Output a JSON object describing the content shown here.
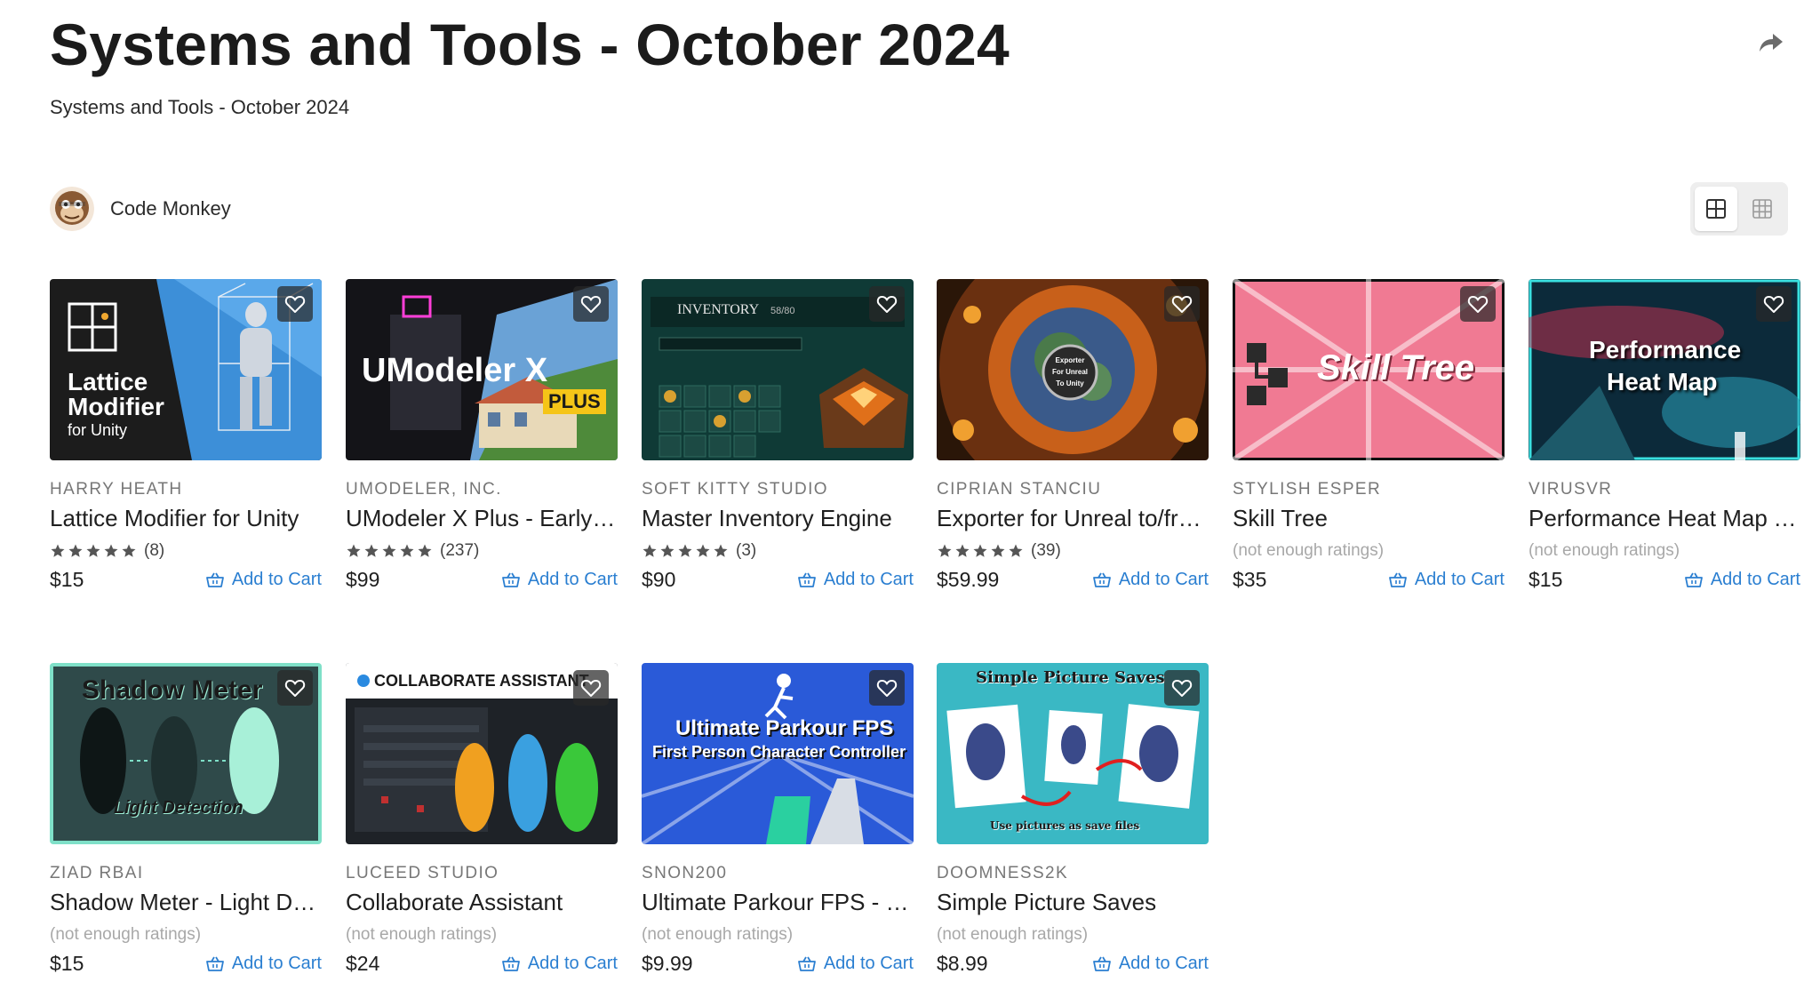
{
  "page": {
    "title": "Systems and Tools - October 2024",
    "subtitle": "Systems and Tools - October 2024"
  },
  "author": {
    "name": "Code Monkey"
  },
  "icons": {
    "share": "share-arrow-icon",
    "grid_large": "grid-large-icon",
    "grid_small": "grid-small-icon",
    "favorite": "heart-icon",
    "cart": "cart-icon",
    "star": "star-icon"
  },
  "colors": {
    "link": "#2b7fd1",
    "muted": "#a8a8a8",
    "publisher": "#777777"
  },
  "products": [
    {
      "publisher": "HARRY HEATH",
      "name": "Lattice Modifier for Unity",
      "rating_count": "(8)",
      "rated": true,
      "stars": 5,
      "price": "$15",
      "cart": "Add to Cart",
      "thumb_title": "Lattice",
      "thumb_title2": "Modifier",
      "thumb_sub": "for Unity"
    },
    {
      "publisher": "UMODELER, INC.",
      "name": "UModeler X Plus - Early Access",
      "rating_count": "(237)",
      "rated": true,
      "stars": 5,
      "price": "$99",
      "cart": "Add to Cart",
      "thumb_title": "UModeler X",
      "thumb_sub": "PLUS"
    },
    {
      "publisher": "SOFT KITTY STUDIO",
      "name": "Master Inventory Engine",
      "rating_count": "(3)",
      "rated": true,
      "stars": 5,
      "price": "$90",
      "cart": "Add to Cart",
      "thumb_title": "INVENTORY",
      "thumb_sub": "58/80"
    },
    {
      "publisher": "CIPRIAN STANCIU",
      "name": "Exporter for Unreal to/from Unity",
      "rating_count": "(39)",
      "rated": true,
      "stars": 5,
      "price": "$59.99",
      "cart": "Add to Cart",
      "thumb_title": "Exporter",
      "thumb_title2": "For Unreal",
      "thumb_sub": "To Unity"
    },
    {
      "publisher": "STYLISH ESPER",
      "name": "Skill Tree",
      "no_rating": "(not enough ratings)",
      "rated": false,
      "price": "$35",
      "cart": "Add to Cart",
      "thumb_title": "Skill Tree"
    },
    {
      "publisher": "VIRUSVR",
      "name": "Performance Heat Map Tool",
      "no_rating": "(not enough ratings)",
      "rated": false,
      "price": "$15",
      "cart": "Add to Cart",
      "thumb_title": "Performance",
      "thumb_sub": "Heat Map"
    },
    {
      "publisher": "ZIAD RBAI",
      "name": "Shadow Meter - Light Detection",
      "no_rating": "(not enough ratings)",
      "rated": false,
      "price": "$15",
      "cart": "Add to Cart",
      "thumb_title": "Shadow Meter",
      "thumb_sub": "Light Detection"
    },
    {
      "publisher": "LUCEED STUDIO",
      "name": "Collaborate Assistant",
      "no_rating": "(not enough ratings)",
      "rated": false,
      "price": "$24",
      "cart": "Add to Cart",
      "thumb_title": "COLLABORATE ASSISTANT"
    },
    {
      "publisher": "SNON200",
      "name": "Ultimate Parkour FPS - First Person Character Controller",
      "no_rating": "(not enough ratings)",
      "rated": false,
      "price": "$9.99",
      "cart": "Add to Cart",
      "thumb_title": "Ultimate Parkour FPS",
      "thumb_sub": "First Person Character Controller"
    },
    {
      "publisher": "DOOMNESS2K",
      "name": "Simple Picture Saves",
      "no_rating": "(not enough ratings)",
      "rated": false,
      "price": "$8.99",
      "cart": "Add to Cart",
      "thumb_title": "Simple Picture Saves",
      "thumb_sub": "Use pictures as save files"
    }
  ]
}
